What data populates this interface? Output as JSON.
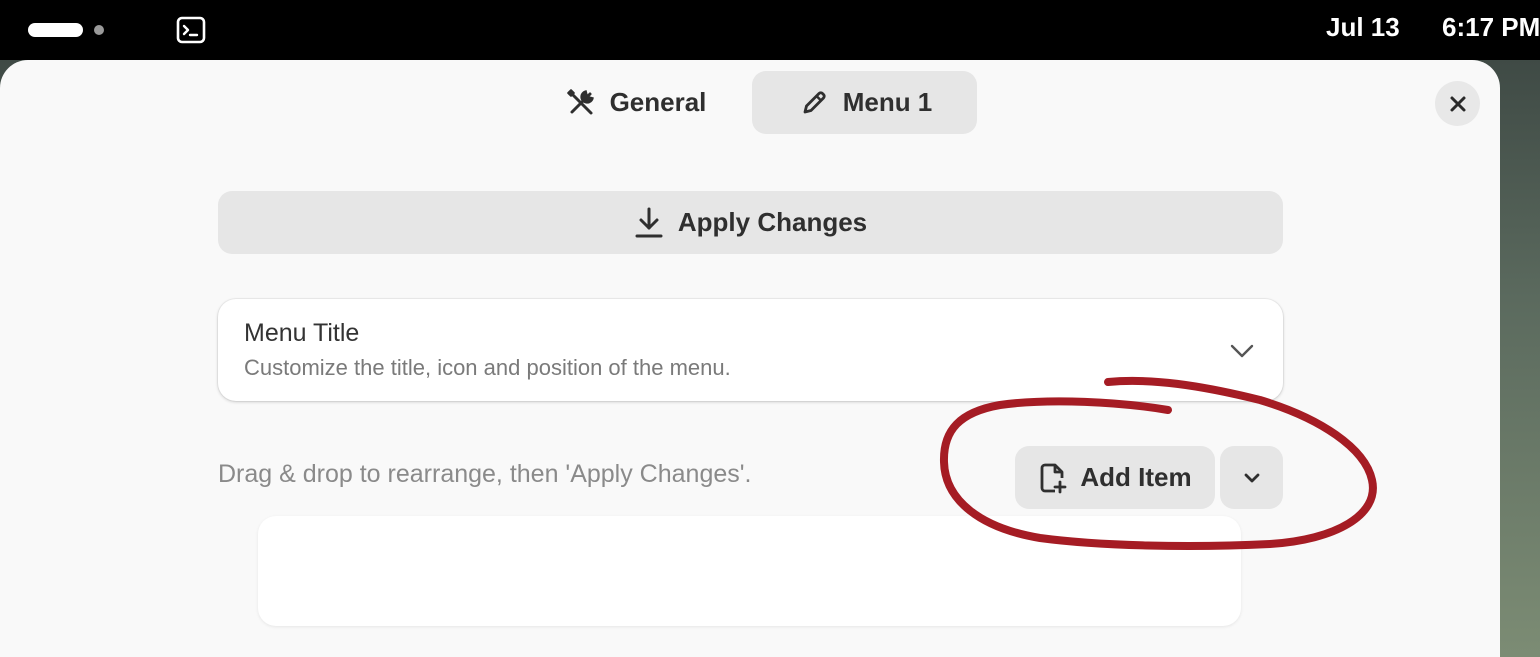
{
  "topbar": {
    "date": "Jul 13",
    "time": "6:17 PM"
  },
  "dialog": {
    "tabs": [
      {
        "label": "General",
        "icon": "tools-icon"
      },
      {
        "label": "Menu 1",
        "icon": "pencil-icon"
      }
    ],
    "active_tab": "Menu 1",
    "close_icon": "close-icon",
    "apply_button": {
      "label": "Apply Changes",
      "icon": "download-icon"
    },
    "menu_title_card": {
      "title": "Menu Title",
      "subtitle": "Customize the title, icon and position of the menu.",
      "icon": "chevron-down-icon"
    },
    "hint": "Drag & drop to rearrange, then 'Apply Changes'.",
    "add_item_button": {
      "label": "Add Item",
      "icon": "file-plus-icon"
    },
    "add_item_menu_icon": "chevron-down-icon"
  },
  "colors": {
    "dialog_bg": "#f9f9f9",
    "button_bg": "#e6e6e6",
    "annotation_stroke": "#a51c24"
  }
}
